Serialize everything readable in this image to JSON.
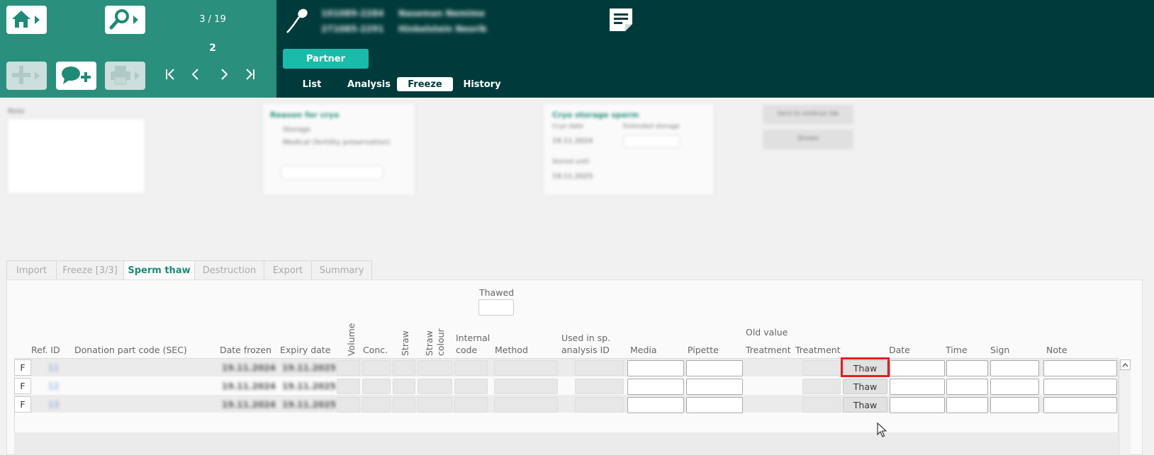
{
  "header": {
    "record_counter": "3 / 19",
    "page_number": "2",
    "patient_rows": [
      {
        "id": "101089-2284",
        "name": "Naseman Nemime"
      },
      {
        "id": "271085-2291",
        "name": "Hinkelstein Neorik"
      }
    ],
    "partner_label": "Partner",
    "tabs": [
      "List",
      "Analysis",
      "Freeze",
      "History"
    ],
    "active_tab": "Freeze"
  },
  "middle": {
    "note_label": "Note",
    "reason_title": "Reason for cryo",
    "reason_opt1": "Storage",
    "reason_opt2": "Medical (fertility preservation)",
    "cryo_title": "Cryo storage sperm",
    "freeze_date_label": "Cryo date",
    "freeze_date": "19.11.2024",
    "expiry_label": "Stored until",
    "expiry_date": "19.11.2025",
    "extended_label": "Extended storage",
    "btn1": "Sent to embryo lab",
    "btn2": "Straws"
  },
  "subtabs": [
    "Import",
    "Freeze [3/3]",
    "Sperm thaw",
    "Destruction",
    "Export",
    "Summary"
  ],
  "active_subtab": "Sperm thaw",
  "thaw_table": {
    "thawed_label": "Thawed",
    "old_value_label": "Old value",
    "headers": {
      "ref_id": "Ref. ID",
      "donation_part_code": "Donation part code (SEC)",
      "date_frozen": "Date frozen",
      "expiry_date": "Expiry date",
      "volume": "Volume",
      "conc": "Conc.",
      "straw": "Straw",
      "straw_colour_1": "Straw",
      "straw_colour_2": "colour",
      "internal_code_1": "Internal",
      "internal_code_2": "code",
      "method": "Method",
      "used_in_1": "Used in sp.",
      "used_in_2": "analysis ID",
      "media": "Media",
      "pipette": "Pipette",
      "treatment_old": "Treatment",
      "treatment": "Treatment",
      "date": "Date",
      "time": "Time",
      "sign": "Sign",
      "note": "Note"
    },
    "rows": [
      {
        "flag": "F",
        "ref_id": "11",
        "date_frozen": "19.11.2024",
        "expiry": "19.11.2025",
        "action": "Thaw"
      },
      {
        "flag": "F",
        "ref_id": "12",
        "date_frozen": "19.11.2024",
        "expiry": "19.11.2025",
        "action": "Thaw"
      },
      {
        "flag": "F",
        "ref_id": "13",
        "date_frozen": "19.11.2024",
        "expiry": "19.11.2025",
        "action": "Thaw"
      }
    ]
  },
  "colors": {
    "header_left": "#2a8f7c",
    "header_right": "#003a3a",
    "accent": "#1abba9",
    "highlight": "#e02020"
  }
}
